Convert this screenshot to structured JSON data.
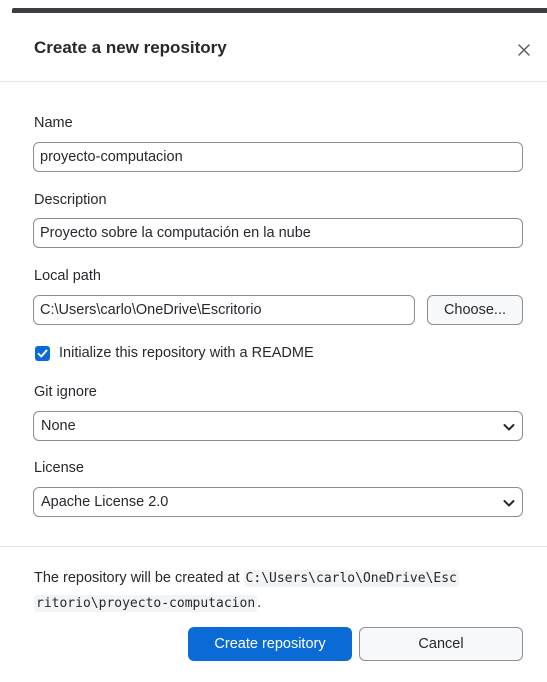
{
  "dialog": {
    "title": "Create a new repository",
    "close_glyph": "×"
  },
  "form": {
    "name": {
      "label": "Name",
      "value": "proyecto-computacion"
    },
    "description": {
      "label": "Description",
      "value": "Proyecto sobre la computación en la nube"
    },
    "local_path": {
      "label": "Local path",
      "value": "C:\\Users\\carlo\\OneDrive\\Escritorio",
      "choose_label": "Choose..."
    },
    "readme": {
      "label": "Initialize this repository with a README",
      "checked": true
    },
    "gitignore": {
      "label": "Git ignore",
      "selected": "None"
    },
    "license": {
      "label": "License",
      "selected": "Apache License 2.0"
    }
  },
  "footer": {
    "message_prefix": "The repository will be created at ",
    "path_line1": "C:\\Users\\carlo\\OneDrive\\Esc",
    "path_line2": "ritorio\\proyecto-computacion",
    "message_suffix": ".",
    "create_label": "Create repository",
    "cancel_label": "Cancel"
  },
  "colors": {
    "accent": "#0a6bd6",
    "border": "#8a8f96",
    "text": "#24292e",
    "topbar": "#3a3d42"
  },
  "icons": {
    "close": "close-icon",
    "check": "check-icon",
    "chevron": "chevron-down-icon"
  }
}
